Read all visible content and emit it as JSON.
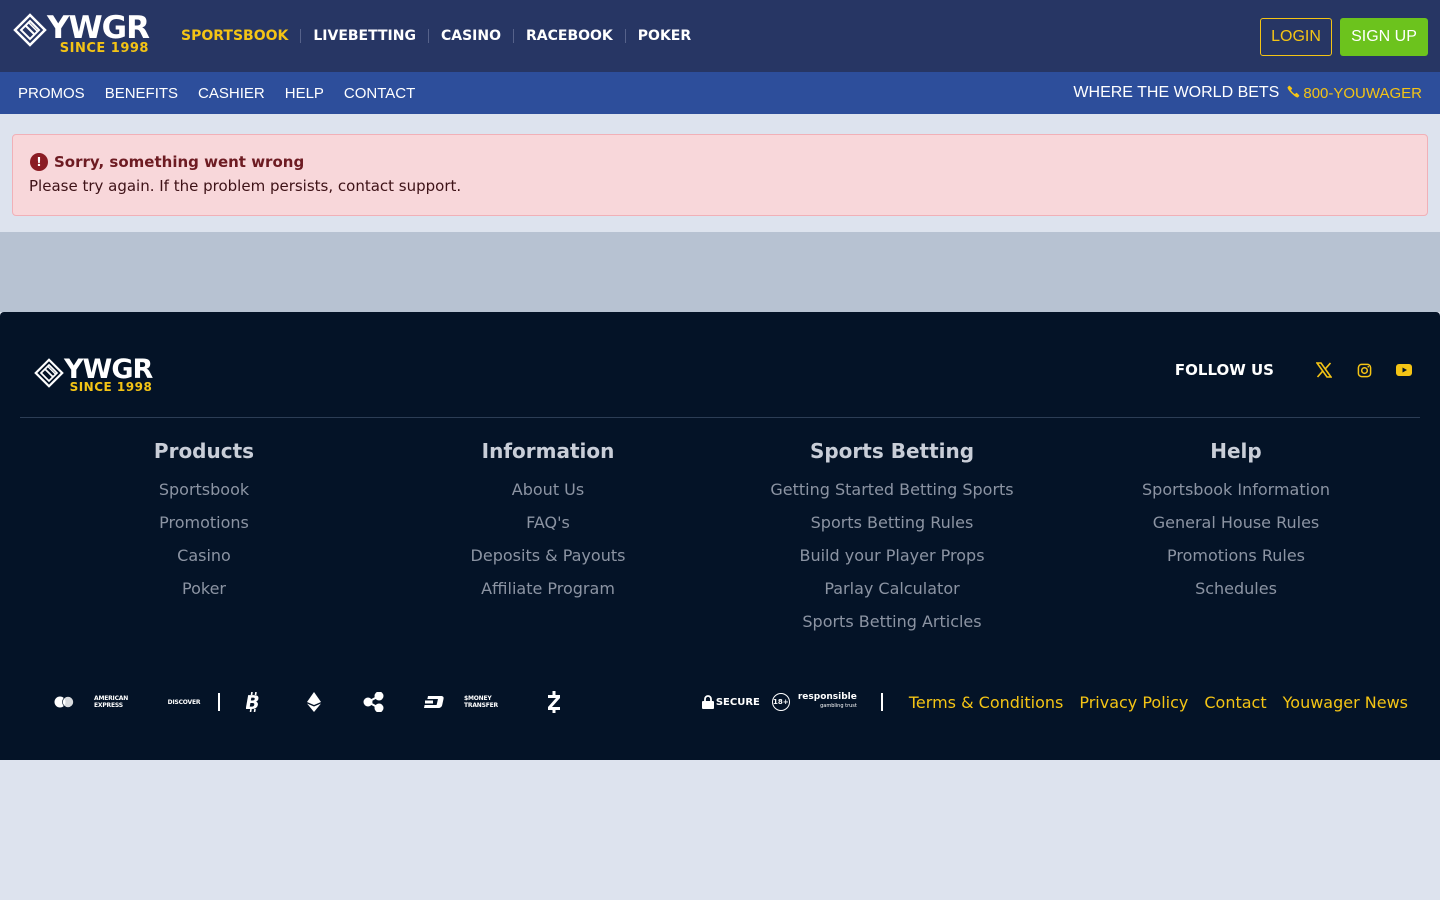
{
  "brand": {
    "name": "YWGR",
    "since": "SINCE 1998",
    "accent": "#f4c415",
    "header_bg": "#273664",
    "subnav_bg": "#2d4e9b",
    "footer_bg": "#041327",
    "signup_color": "#6cc31d"
  },
  "main_nav": {
    "items": [
      {
        "label": "SPORTSBOOK",
        "active": true
      },
      {
        "label": "LIVEBETTING",
        "active": false
      },
      {
        "label": "CASINO",
        "active": false
      },
      {
        "label": "RACEBOOK",
        "active": false
      },
      {
        "label": "POKER",
        "active": false
      }
    ]
  },
  "auth": {
    "login_label": "LOGIN",
    "signup_label": "SIGN UP"
  },
  "sub_nav": {
    "items": [
      "PROMOS",
      "BENEFITS",
      "CASHIER",
      "HELP",
      "CONTACT"
    ],
    "tagline": "WHERE THE WORLD BETS",
    "phone": "800-YOUWAGER",
    "phone_icon": "phone-icon"
  },
  "alert": {
    "icon": "exclamation-circle-icon",
    "title": "Sorry, something went wrong",
    "message": "Please try again. If the problem persists, contact support."
  },
  "footer": {
    "follow_label": "FOLLOW US",
    "social": [
      "x-icon",
      "instagram-icon",
      "youtube-icon"
    ],
    "columns": [
      {
        "title": "Products",
        "links": [
          "Sportsbook",
          "Promotions",
          "Casino",
          "Poker"
        ]
      },
      {
        "title": "Information",
        "links": [
          "About Us",
          "FAQ's",
          "Deposits & Payouts",
          "Affiliate Program"
        ]
      },
      {
        "title": "Sports Betting",
        "links": [
          "Getting Started Betting Sports",
          "Sports Betting Rules",
          "Build your Player Props",
          "Parlay Calculator",
          "Sports Betting Articles"
        ]
      },
      {
        "title": "Help",
        "links": [
          "Sportsbook Information",
          "General House Rules",
          "Promotions Rules",
          "Schedules"
        ]
      }
    ],
    "payments": {
      "amex": "AMERICAN EXPRESS",
      "discover": "DISCOVER",
      "moneytransfer": "$MONEY TRANSFER",
      "icons": [
        "mastercard-icon",
        "amex-icon",
        "discover-icon",
        "bitcoin-icon",
        "ethereum-icon",
        "ripple-icon",
        "dash-icon",
        "money-transfer-icon",
        "zcash-icon"
      ]
    },
    "trust": {
      "secure": "SECURE",
      "age": "18+",
      "responsible": "responsible",
      "responsible_sub": "gambling trust"
    },
    "links": [
      "Terms & Conditions",
      "Privacy Policy",
      "Contact",
      "Youwager News"
    ]
  }
}
